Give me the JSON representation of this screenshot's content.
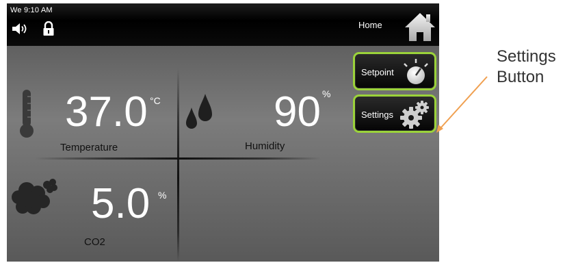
{
  "statusbar": {
    "clock": "We 9:10 AM",
    "home_label": "Home"
  },
  "readings": {
    "temperature": {
      "value": "37.0",
      "unit": "°C",
      "label": "Temperature"
    },
    "humidity": {
      "value": "90",
      "unit": "%",
      "label": "Humidity"
    },
    "co2": {
      "value": "5.0",
      "unit": "%",
      "label": "CO2"
    }
  },
  "buttons": {
    "setpoint": "Setpoint",
    "settings": "Settings"
  },
  "annotation": {
    "line1": "Settings",
    "line2": "Button"
  },
  "colors": {
    "button_border": "#9bd33a",
    "arrow": "#f0a050"
  }
}
